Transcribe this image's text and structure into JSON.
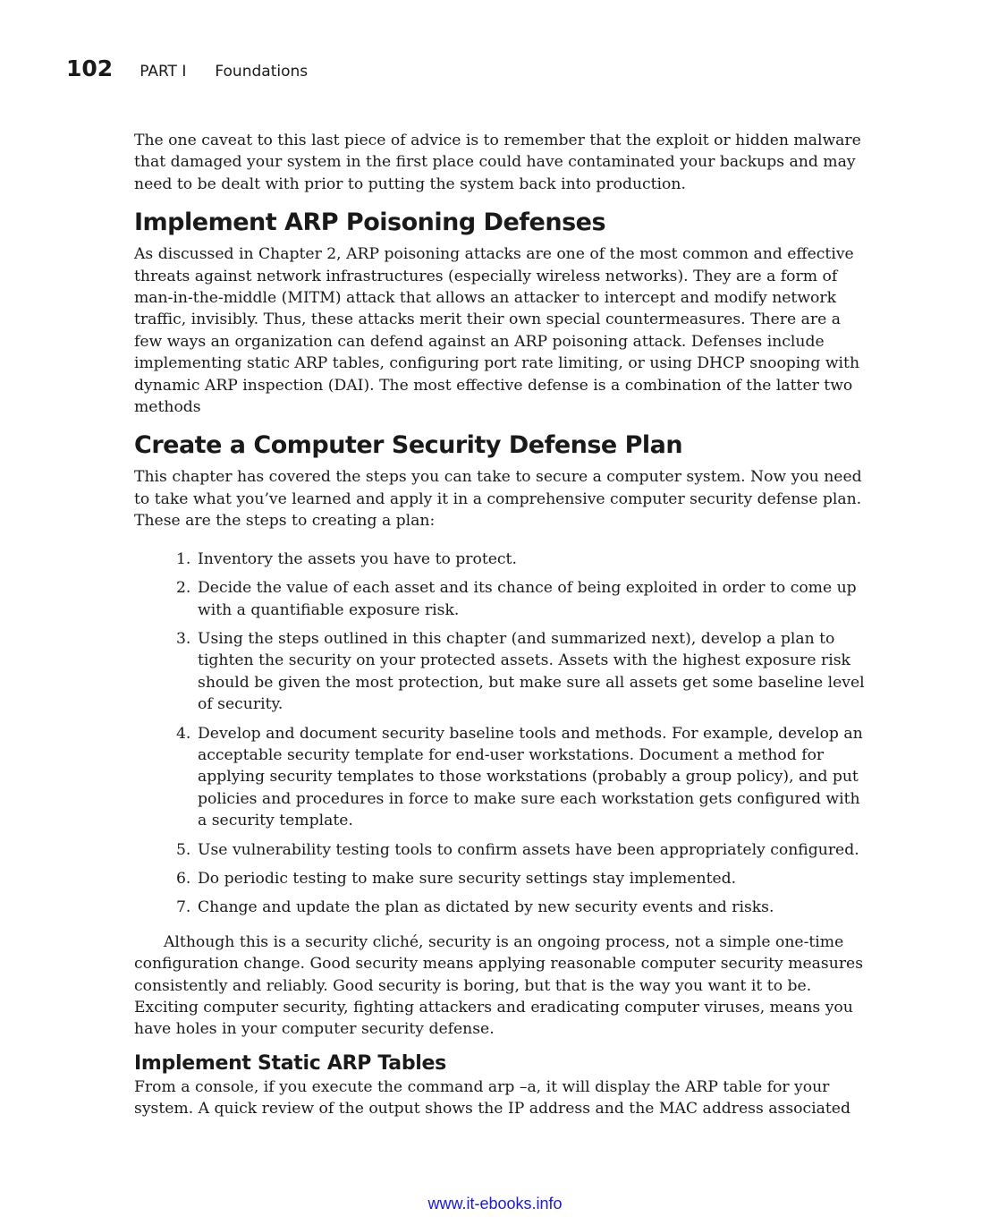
{
  "header": {
    "page_number": "102",
    "part": "PART I",
    "section": "Foundations"
  },
  "intro_paragraph": "The one caveat to this last piece of advice is to remember that the exploit or hidden malware that damaged your system in the first place could have contaminated your backups and may need to be dealt with prior to putting the system back into production.",
  "arp_section": {
    "heading": "Implement ARP Poisoning Defenses",
    "paragraph": "As discussed in Chapter 2, ARP poisoning attacks are one of the most common and effective threats against network infrastructures (especially wireless networks). They are a form of man-in-the-middle (MITM) attack that allows an attacker to intercept and modify network traffic, invisibly. Thus, these attacks merit their own special countermeasures. There are a few ways an organization can defend against an ARP poisoning attack. Defenses include implementing static ARP tables, configuring port rate limiting, or using DHCP snooping with dynamic ARP inspection (DAI). The most effective defense is a combination of the latter two methods"
  },
  "plan_section": {
    "heading": "Create a Computer Security Defense Plan",
    "paragraph": "This chapter has covered the steps you can take to secure a computer system. Now you need to take what you’ve learned and apply it in a comprehensive computer security defense plan. These are the steps to creating a plan:",
    "steps": [
      {
        "number": "1.",
        "text": "Inventory the assets you have to protect."
      },
      {
        "number": "2.",
        "text": "Decide the value of each asset and its chance of being exploited in order to come up with a quantifiable exposure risk."
      },
      {
        "number": "3.",
        "text": "Using the steps outlined in this chapter (and summarized next), develop a plan to tighten the security on your protected assets. Assets with the highest exposure risk should be given the most protection, but make sure all assets get some baseline level of security."
      },
      {
        "number": "4.",
        "text": "Develop and document security baseline tools and methods. For example, develop an acceptable security template for end-user workstations. Document a method for applying security templates to those workstations (probably a group policy), and put policies and procedures in force to make sure each workstation gets configured with a security template."
      },
      {
        "number": "5.",
        "text": "Use vulnerability testing tools to confirm assets have been appropriately configured."
      },
      {
        "number": "6.",
        "text": "Do periodic testing to make sure security settings stay implemented."
      },
      {
        "number": "7.",
        "text": "Change and update the plan as dictated by new security events and risks."
      }
    ],
    "closing_paragraph": "Although this is a security cliché, security is an ongoing process, not a simple one-time configuration change. Good security means applying reasonable computer security measures consistently and reliably. Good security is boring, but that is the way you want it to be. Exciting computer security, fighting attackers and eradicating computer viruses, means you have holes in your computer security defense."
  },
  "static_arp_section": {
    "heading": "Implement Static ARP Tables",
    "paragraph": "From a console, if you execute the command arp –a, it will display the ARP table for your system. A quick review of the output shows the IP address and the MAC address associated"
  },
  "footer": {
    "link_text": "www.it-ebooks.info",
    "link_color": "#1a1ad4"
  }
}
